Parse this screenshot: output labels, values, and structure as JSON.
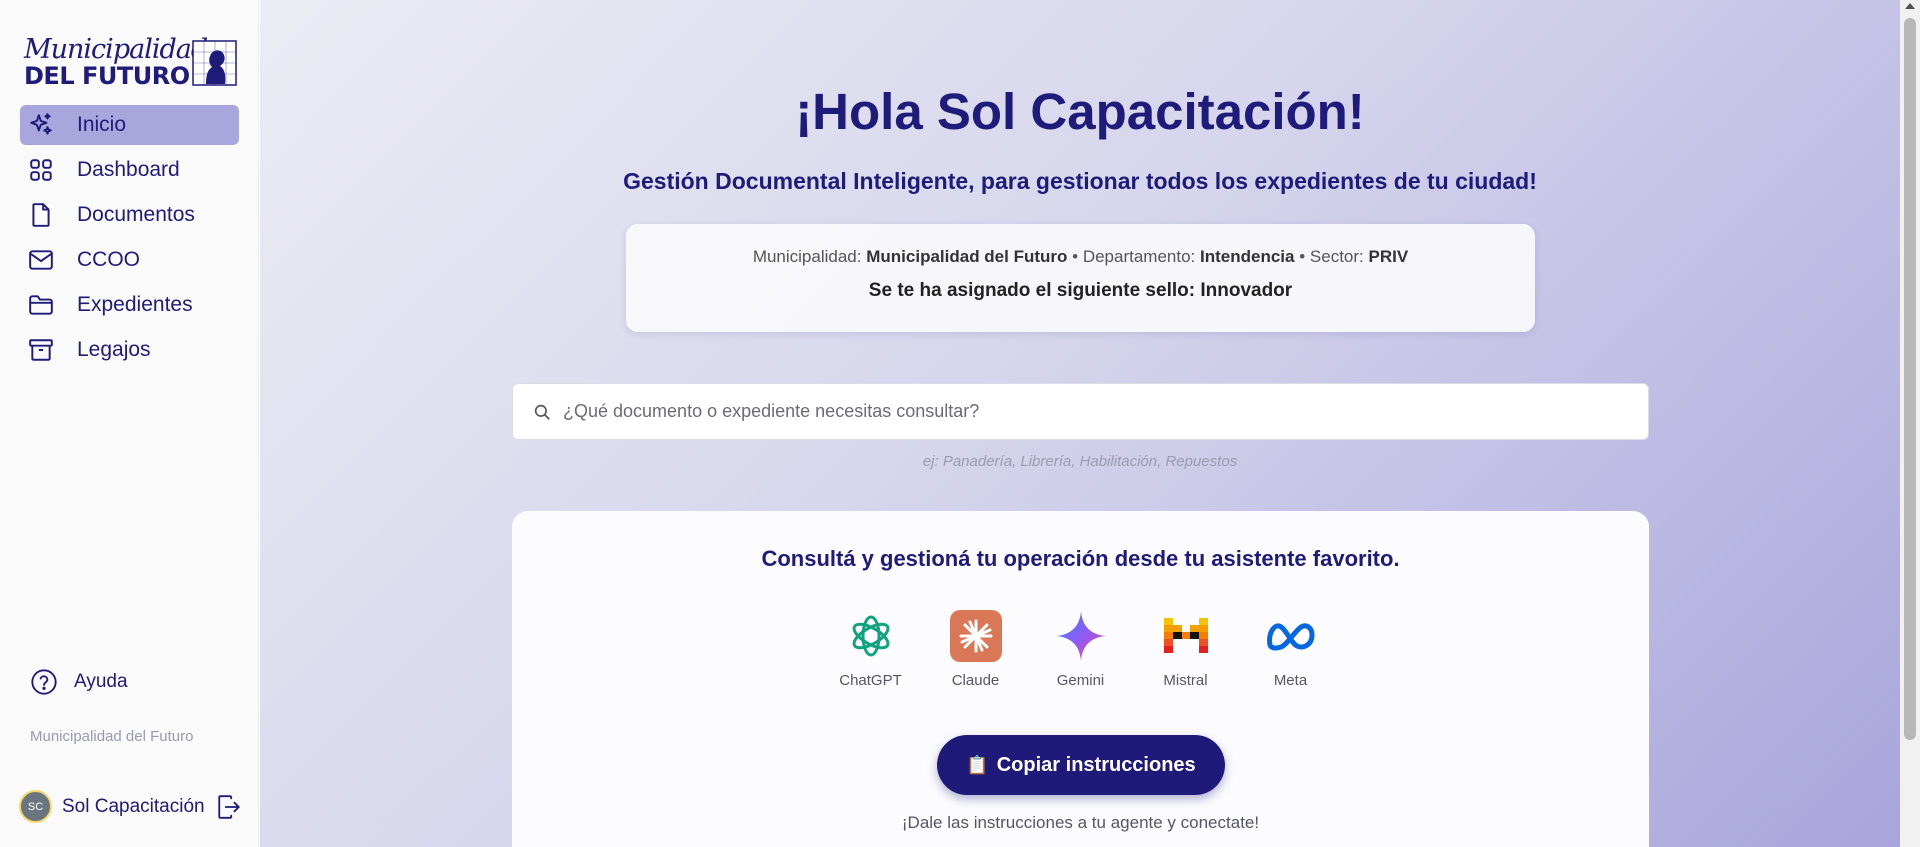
{
  "sidebar": {
    "logo": {
      "line1": "Municipalidad",
      "line2": "DEL FUTURO"
    },
    "items": [
      {
        "label": "Inicio",
        "icon": "sparkles-icon",
        "active": true
      },
      {
        "label": "Dashboard",
        "icon": "grid-icon",
        "active": false
      },
      {
        "label": "Documentos",
        "icon": "file-icon",
        "active": false
      },
      {
        "label": "CCOO",
        "icon": "mail-icon",
        "active": false
      },
      {
        "label": "Expedientes",
        "icon": "folder-icon",
        "active": false
      },
      {
        "label": "Legajos",
        "icon": "archive-icon",
        "active": false
      }
    ],
    "help": {
      "label": "Ayuda",
      "icon": "help-circle-icon"
    },
    "footer": "Municipalidad del Futuro",
    "user": {
      "initials": "SC",
      "name": "Sol Capacitación",
      "logout_icon": "logout-icon"
    }
  },
  "main": {
    "greeting": "¡Hola Sol Capacitación!",
    "subtitle": "Gestión Documental Inteligente, para gestionar todos los expedientes de tu ciudad!",
    "info": {
      "muni_label": "Municipalidad:",
      "muni_value": "Municipalidad del Futuro",
      "sep": "•",
      "dept_label": "Departamento:",
      "dept_value": "Intendencia",
      "sector_label": "Sector:",
      "sector_value": "PRIV",
      "seal_label": "Se te ha asignado el siguiente sello:",
      "seal_value": "Innovador"
    },
    "search": {
      "placeholder": "¿Qué documento o expediente necesitas consultar?",
      "value": "",
      "hint": "ej: Panadería, Librería, Habilitación, Repuestos"
    },
    "assistants": {
      "title": "Consultá y gestioná tu operación desde tu asistente favorito.",
      "items": [
        {
          "label": "ChatGPT",
          "icon": "chatgpt-icon"
        },
        {
          "label": "Claude",
          "icon": "claude-icon"
        },
        {
          "label": "Gemini",
          "icon": "gemini-icon"
        },
        {
          "label": "Mistral",
          "icon": "mistral-icon"
        },
        {
          "label": "Meta",
          "icon": "meta-icon"
        }
      ],
      "copy_button": "Copiar instrucciones",
      "copy_icon": "📋",
      "footer": "¡Dale las instrucciones a tu agente y conectate!"
    }
  },
  "colors": {
    "brand": "#1e1b7a",
    "active_nav": "#a9a6de",
    "button": "#1f1a7a"
  }
}
